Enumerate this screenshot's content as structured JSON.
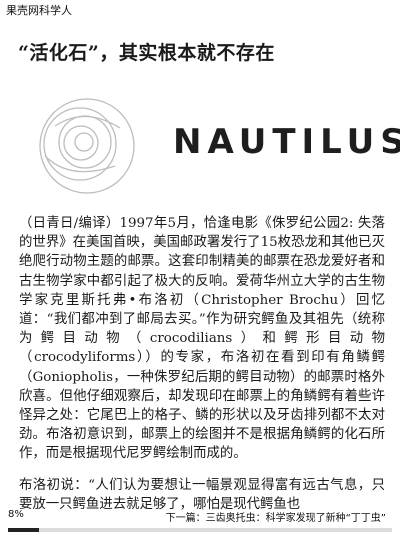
{
  "app": {
    "source_label": "果壳网科学人"
  },
  "article": {
    "title": "“活化石”，其实根本就不存在",
    "logo_text": "NAUTILUS",
    "paragraphs": [
      "（日青日/编译）1997年5月，恰逢电影《侏罗纪公园2: 失落的世界》在美国首映，美国邮政署发行了15枚恐龙和其他已灭绝爬行动物主题的邮票。这套印制精美的邮票在恐龙爱好者和古生物学家中都引起了极大的反响。爱荷华州立大学的古生物学家克里斯托弗•布洛初（Christopher Brochu）回忆道：“我们都冲到了邮局去买。”作为研究鳄鱼及其祖先（统称为鳄目动物（crocodilians）和鳄形目动物（crocodyliforms））的专家，布洛初在看到印有角鳞鳄（Goniopholis，一种侏罗纪后期的鳄目动物）的邮票时格外欣喜。但他仔细观察后，却发现印在邮票上的角鳞鳄有着些许怪异之处：它尾巴上的格子、鳞的形状以及牙齿排列都不太对劲。布洛初意识到，邮票上的绘图并不是根据角鳞鳄的化石所作，而是根据现代尼罗鳄绘制而成的。",
      "布洛初说：“人们认为要想让一幅景观显得富有远古气息，只要放一只鳄鱼进去就足够了，哪怕是现代鳄鱼也"
    ]
  },
  "footer": {
    "progress_label": "8%",
    "progress_value": 0.08,
    "next_article": "下一篇：三齿奥托虫：科学家发现了新种“丁丁虫”"
  }
}
